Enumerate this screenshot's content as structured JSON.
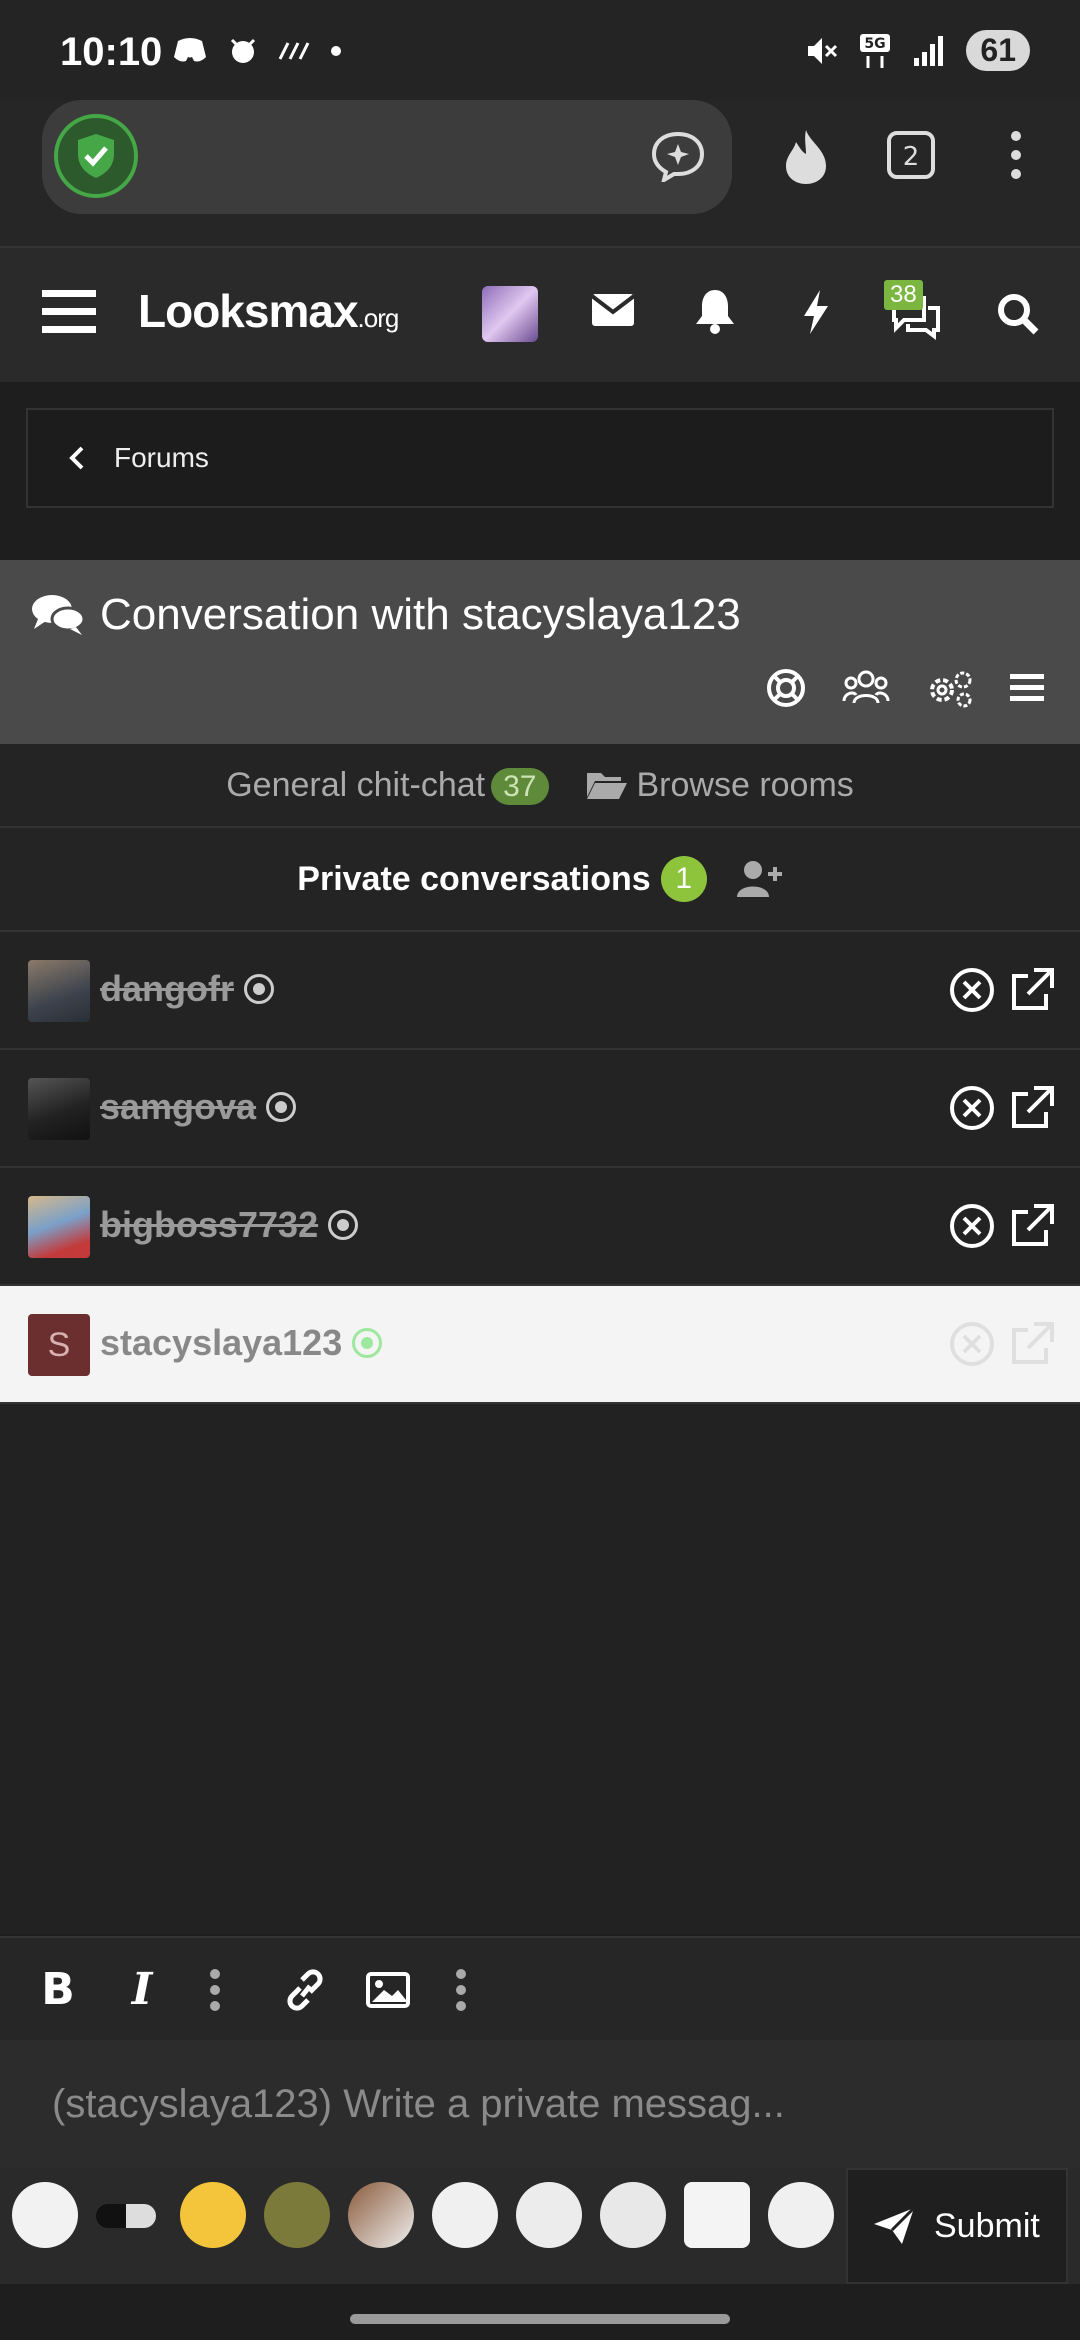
{
  "status_bar": {
    "time": "10:10",
    "battery": "61",
    "network": "5G"
  },
  "header": {
    "logo_main": "Looksmax",
    "logo_suffix": ".org",
    "chat_badge": "38"
  },
  "breadcrumb": {
    "label": "Forums"
  },
  "conversation": {
    "title": "Conversation with stacyslaya123"
  },
  "rooms": {
    "general_label": "General chit-chat",
    "general_count": "37",
    "browse_label": "Browse rooms",
    "private_label": "Private conversations",
    "private_count": "1"
  },
  "conversations": [
    {
      "name": "dangofr",
      "initial": "",
      "avatar_color": "#5a5f6a",
      "active": false
    },
    {
      "name": "samgova",
      "initial": "",
      "avatar_color": "#3c3c3c",
      "active": false
    },
    {
      "name": "bigboss7732",
      "initial": "",
      "avatar_color": "#7aa0c8",
      "active": false
    },
    {
      "name": "stacyslaya123",
      "initial": "S",
      "avatar_color": "#6b2f2f",
      "active": true
    }
  ],
  "editor": {
    "placeholder": "(stacyslaya123) Write a private messag...",
    "submit_label": "Submit"
  },
  "colors": {
    "accent": "#7ab640",
    "online": "#9ee79e",
    "header_bg": "#4a4a4a"
  }
}
